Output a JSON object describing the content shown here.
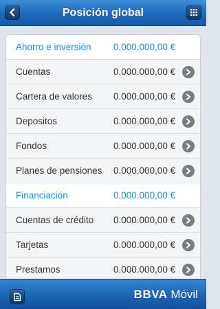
{
  "header": {
    "title": "Posición global",
    "back_icon": "chevron-left-icon",
    "menu_icon": "grid-icon"
  },
  "list": {
    "rows": [
      {
        "label": "Ahorro e inversión",
        "amount": "0.000.000,00 €",
        "type": "section"
      },
      {
        "label": "Cuentas",
        "amount": "0.000.000,00 €",
        "type": "item"
      },
      {
        "label": "Cartera de valores",
        "amount": "0.000.000,00 €",
        "type": "item"
      },
      {
        "label": "Depositos",
        "amount": "0.000.000,00 €",
        "type": "item"
      },
      {
        "label": "Fondos",
        "amount": "0.000.000,00 €",
        "type": "item"
      },
      {
        "label": "Planes de pensiones",
        "amount": "0.000.000,00 €",
        "type": "item"
      },
      {
        "label": "Financiación",
        "amount": "0.000.000,00 €",
        "type": "section"
      },
      {
        "label": "Cuentas de crédito",
        "amount": "0.000.000,00 €",
        "type": "item"
      },
      {
        "label": "Tarjetas",
        "amount": "0.000.000,00 €",
        "type": "item"
      },
      {
        "label": "Prestamos",
        "amount": "0.000.000,00 €",
        "type": "item"
      }
    ],
    "row_icon": "chevron-right-circle-icon"
  },
  "footer": {
    "brand_bold": "BBVA",
    "brand_regular": " Móvil",
    "left_icon": "document-icon"
  },
  "colors": {
    "header_blue": "#1f6cbd",
    "section_text": "#1b8fd9",
    "text": "#333333",
    "chevron_bg": "#7a7d80"
  }
}
